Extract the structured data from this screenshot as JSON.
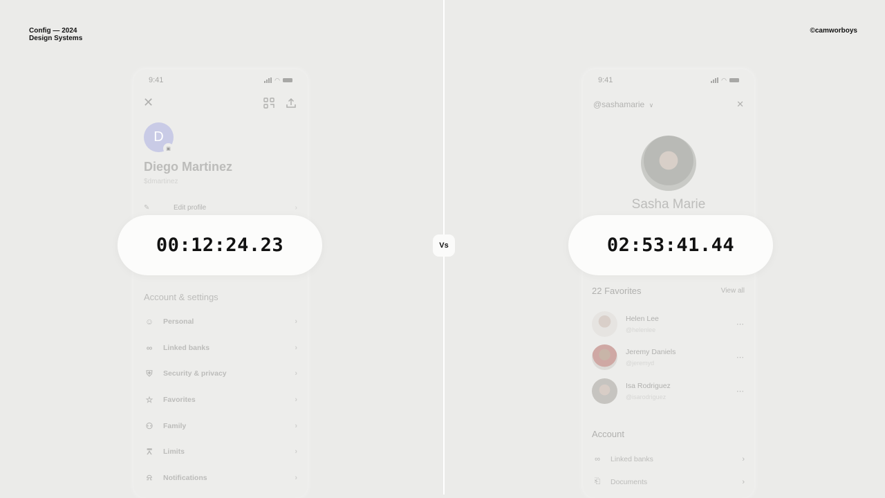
{
  "header": {
    "event_line1": "Config — 2024",
    "event_line2": "Design Systems",
    "credit": "©camworboys"
  },
  "vs_label": "Vs",
  "left_phone": {
    "status_time": "9:41",
    "icons": {
      "close": "close-icon",
      "qr": "qr-code-icon",
      "share": "share-icon"
    },
    "avatar_initial": "D",
    "name": "Diego Martinez",
    "handle": "$dmartinez",
    "edit_profile": "Edit profile",
    "section_title": "Account & settings",
    "menu": [
      {
        "label": "Personal",
        "icon": "person-icon"
      },
      {
        "label": "Linked banks",
        "icon": "link-icon"
      },
      {
        "label": "Security & privacy",
        "icon": "shield-icon"
      },
      {
        "label": "Favorites",
        "icon": "star-icon"
      },
      {
        "label": "Family",
        "icon": "family-icon"
      },
      {
        "label": "Limits",
        "icon": "limits-icon"
      },
      {
        "label": "Notifications",
        "icon": "bell-icon"
      }
    ],
    "timer": "00:12:24.23"
  },
  "right_phone": {
    "status_time": "9:41",
    "account_switcher": "@sashamarie",
    "name": "Sasha Marie",
    "favorites_title": "22 Favorites",
    "view_all": "View all",
    "favorites": [
      {
        "name": "Helen Lee",
        "handle": "@helenlee"
      },
      {
        "name": "Jeremy Daniels",
        "handle": "@jeremyd"
      },
      {
        "name": "Isa Rodriguez",
        "handle": "@isarodriguez"
      }
    ],
    "account_title": "Account",
    "account_items": [
      {
        "label": "Linked banks",
        "icon": "link-icon"
      },
      {
        "label": "Documents",
        "icon": "document-icon"
      }
    ],
    "timer": "02:53:41.44"
  }
}
